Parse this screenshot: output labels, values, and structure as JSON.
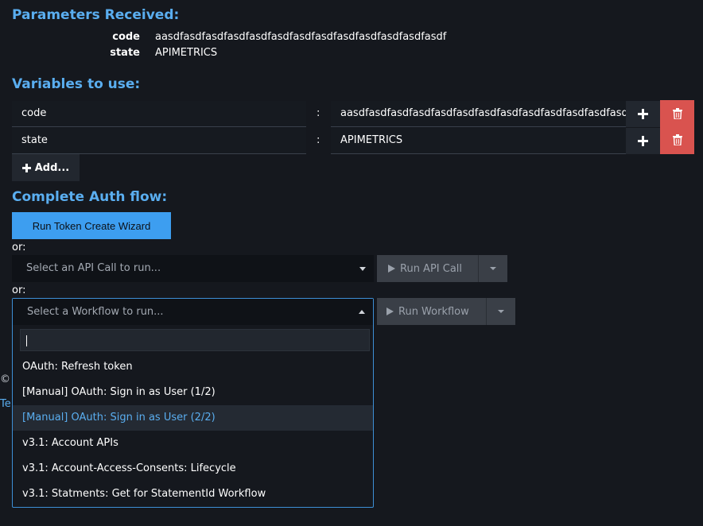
{
  "params": {
    "heading": "Parameters Received:",
    "rows": [
      {
        "key": "code",
        "value": "aasdfasdfasdfasdfasdfasdfasdfasdfasdfasdfasdfasdfasdf"
      },
      {
        "key": "state",
        "value": "APIMETRICS"
      }
    ]
  },
  "variables": {
    "heading": "Variables to use:",
    "separator": ":",
    "rows": [
      {
        "name": "code",
        "value": "aasdfasdfasdfasdfasdfasdfasdfasdfasdfasdfasdfasdfasdf"
      },
      {
        "name": "state",
        "value": "APIMETRICS"
      }
    ],
    "add_label": "Add..."
  },
  "auth": {
    "heading": "Complete Auth flow:",
    "wizard_label": "Run Token Create Wizard",
    "or_1": "or:",
    "api_select_placeholder": "Select an API Call to run...",
    "run_api_label": "Run API Call",
    "or_2": "or:",
    "workflow_select_placeholder": "Select a Workflow to run...",
    "run_workflow_label": "Run Workflow"
  },
  "workflow_dropdown": {
    "search_value": "",
    "items": [
      "OAuth: Refresh token",
      "[Manual] OAuth: Sign in as User (1/2)",
      "[Manual] OAuth: Sign in as User (2/2)",
      "v3.1: Account APIs",
      "v3.1: Account-Access-Consents: Lifecycle",
      "v3.1: Statments: Get for StatementId Workflow"
    ],
    "highlighted_index": 2
  },
  "footer": {
    "copyright_fragment": "©",
    "link_fragment": "Te"
  },
  "colors": {
    "accent": "#5aaef0",
    "primary_button": "#3d9ef0",
    "delete_button": "#d9534f",
    "background": "#15181e"
  },
  "icons": [
    "plus-icon",
    "trash-icon",
    "play-icon",
    "caret-down-icon",
    "caret-up-icon"
  ]
}
